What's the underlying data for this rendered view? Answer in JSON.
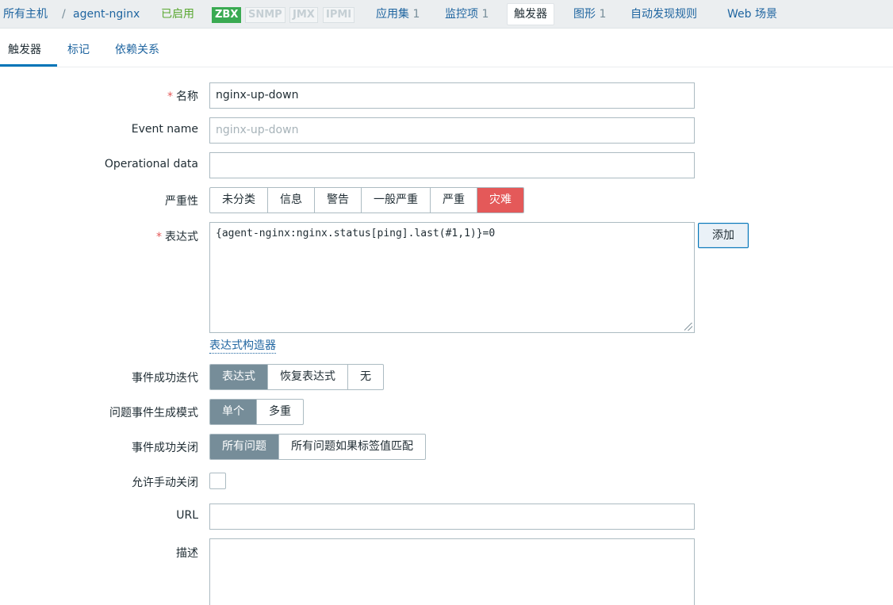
{
  "breadcrumb": {
    "all_hosts": "所有主机",
    "separator": "/",
    "host": "agent-nginx",
    "status": "已启用"
  },
  "availability": {
    "zbx": "ZBX",
    "snmp": "SNMP",
    "jmx": "JMX",
    "ipmi": "IPMI"
  },
  "host_tabs": {
    "applications": {
      "label": "应用集",
      "count": "1"
    },
    "items": {
      "label": "监控项",
      "count": "1"
    },
    "triggers": {
      "label": "触发器"
    },
    "graphs": {
      "label": "图形",
      "count": "1"
    },
    "discovery": {
      "label": "自动发现规则"
    },
    "web": {
      "label": "Web 场景"
    }
  },
  "sub_tabs": [
    "触发器",
    "标记",
    "依赖关系"
  ],
  "form": {
    "name": {
      "label": "名称",
      "value": "nginx-up-down"
    },
    "event_name": {
      "label": "Event name",
      "placeholder": "nginx-up-down"
    },
    "operational_data": {
      "label": "Operational data",
      "value": ""
    },
    "severity": {
      "label": "严重性",
      "options": [
        "未分类",
        "信息",
        "警告",
        "一般严重",
        "严重",
        "灾难"
      ],
      "selected": "灾难",
      "selected_color": "#e45959"
    },
    "expression": {
      "label": "表达式",
      "value": "{agent-nginx:nginx.status[ping].last(#1,1)}=0",
      "add_button": "添加",
      "constructor_link": "表达式构造器"
    },
    "ok_event_generation": {
      "label": "事件成功迭代",
      "options": [
        "表达式",
        "恢复表达式",
        "无"
      ],
      "selected": "表达式"
    },
    "problem_event_mode": {
      "label": "问题事件生成模式",
      "options": [
        "单个",
        "多重"
      ],
      "selected": "单个"
    },
    "ok_event_closes": {
      "label": "事件成功关闭",
      "options": [
        "所有问题",
        "所有问题如果标签值匹配"
      ],
      "selected": "所有问题"
    },
    "manual_close": {
      "label": "允许手动关闭",
      "checked": false
    },
    "url": {
      "label": "URL",
      "value": ""
    },
    "description": {
      "label": "描述",
      "value": ""
    }
  },
  "colors": {
    "link": "#1f65a0",
    "enabled": "#59a831",
    "zbx_badge": "#3aaa52",
    "selected_segment": "#768d99",
    "required_asterisk": "#e45959"
  }
}
